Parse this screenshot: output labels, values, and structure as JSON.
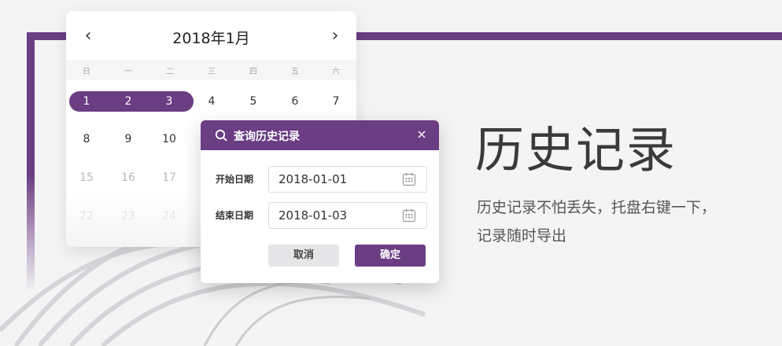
{
  "calendar": {
    "title": "2018年1月",
    "prev_glyph": "‹",
    "next_glyph": "›",
    "weekdays": [
      "日",
      "一",
      "二",
      "三",
      "四",
      "五",
      "六"
    ],
    "rows": [
      [
        "1",
        "2",
        "3",
        "4",
        "5",
        "6",
        "7"
      ],
      [
        "8",
        "9",
        "10",
        "",
        "",
        "",
        ""
      ],
      [
        "15",
        "16",
        "17",
        "",
        "",
        "",
        ""
      ],
      [
        "22",
        "23",
        "24",
        "",
        "",
        "",
        ""
      ]
    ]
  },
  "dialog": {
    "title": "查询历史记录",
    "close_glyph": "×",
    "start_label": "开始日期",
    "start_value": "2018-01-01",
    "end_label": "结束日期",
    "end_value": "2018-01-03",
    "cancel_label": "取消",
    "ok_label": "确定"
  },
  "hero": {
    "title": "历史记录",
    "line1": "历史记录不怕丢失，托盘右键一下，",
    "line2": "记录随时导出"
  },
  "colors": {
    "accent": "#6b3d83",
    "background": "#f4f4f5"
  }
}
